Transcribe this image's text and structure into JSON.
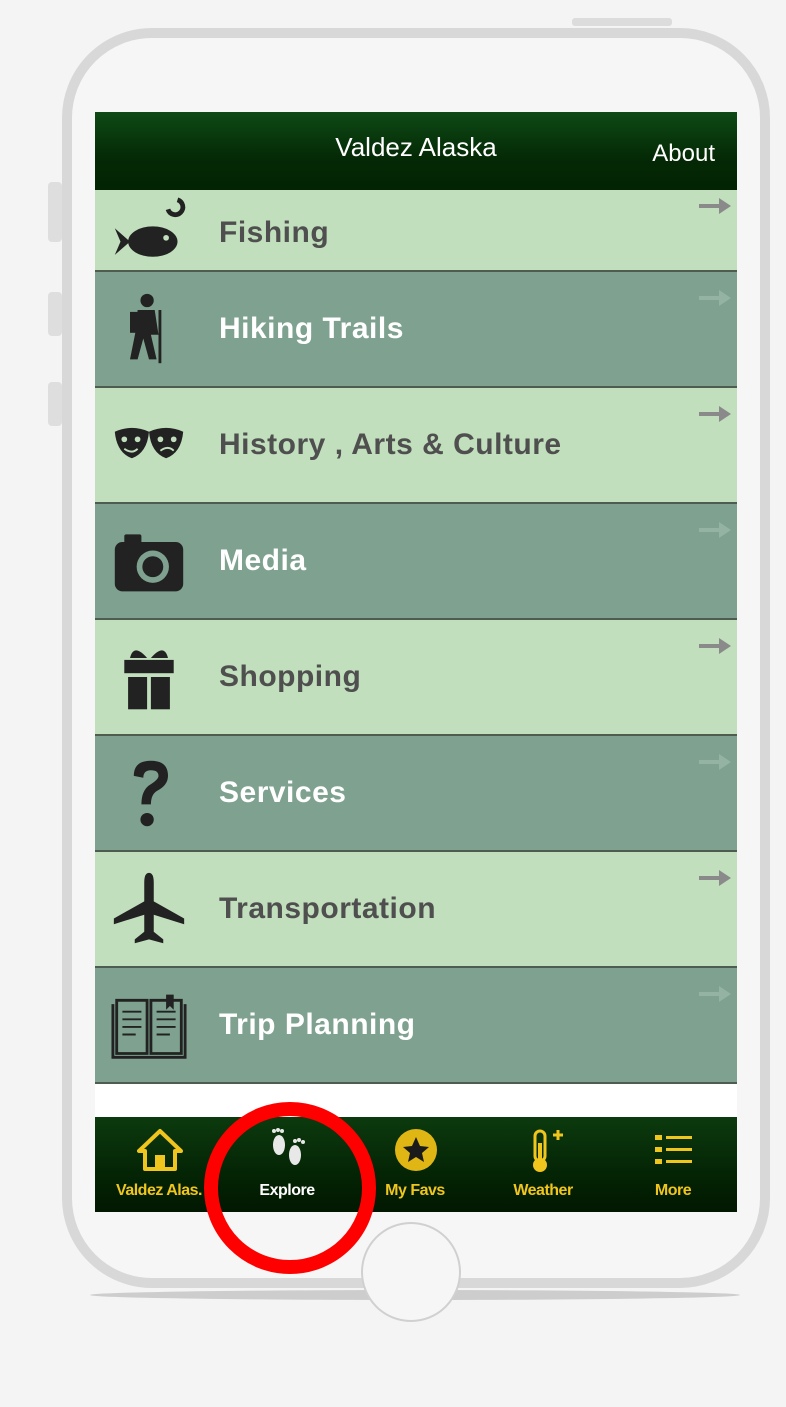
{
  "header": {
    "title": "Valdez Alaska",
    "about": "About"
  },
  "menu": [
    {
      "label": "Fishing",
      "icon": "fish-icon"
    },
    {
      "label": "Hiking Trails",
      "icon": "hiker-icon"
    },
    {
      "label": "History , Arts & Culture",
      "icon": "theater-masks-icon"
    },
    {
      "label": "Media",
      "icon": "camera-icon"
    },
    {
      "label": "Shopping",
      "icon": "gift-icon"
    },
    {
      "label": "Services",
      "icon": "question-mark-icon"
    },
    {
      "label": "Transportation",
      "icon": "airplane-icon"
    },
    {
      "label": "Trip Planning",
      "icon": "book-icon"
    }
  ],
  "tabs": [
    {
      "label": "Valdez Alas.",
      "icon": "home-icon"
    },
    {
      "label": "Explore",
      "icon": "footprints-icon",
      "active": true
    },
    {
      "label": "My Favs",
      "icon": "star-icon"
    },
    {
      "label": "Weather",
      "icon": "thermometer-icon"
    },
    {
      "label": "More",
      "icon": "list-icon"
    }
  ],
  "colors": {
    "header_bg": "#042905",
    "row_light": "#c1dfbc",
    "row_dark": "#7ea28f",
    "tab_label": "#f0c51e",
    "highlight_circle": "#ff0000"
  }
}
